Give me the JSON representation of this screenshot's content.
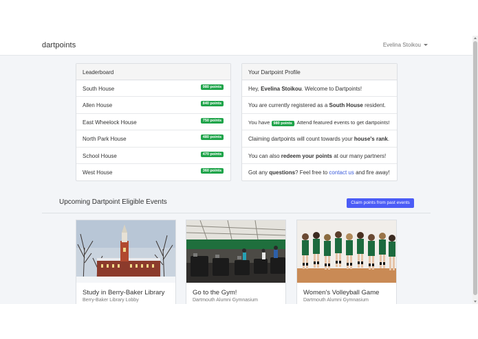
{
  "app": {
    "brand": "dartpoints",
    "user_name": "Evelina Stoikou"
  },
  "leaderboard": {
    "title": "Leaderboard",
    "rows": [
      {
        "house": "South House",
        "points": "980 points"
      },
      {
        "house": "Allen House",
        "points": "840 points"
      },
      {
        "house": "East Wheelock House",
        "points": "750 points"
      },
      {
        "house": "North Park House",
        "points": "480 points"
      },
      {
        "house": "School House",
        "points": "470 points"
      },
      {
        "house": "West House",
        "points": "360 points"
      }
    ]
  },
  "profile": {
    "title": "Your Dartpoint Profile",
    "greeting_pre": "Hey, ",
    "greeting_name": "Evelina Stoikou",
    "greeting_post": ". Welcome to Dartpoints!",
    "registered_pre": "You are currently registered as a ",
    "registered_house": "South House",
    "registered_post": " resident.",
    "have_pre": "You have ",
    "have_points": "980 points",
    "have_post": ". Attend featured events to get dartpoints!",
    "claim_pre": "Claiming dartpoints will count towards your ",
    "claim_bold": "house's rank",
    "claim_post": ".",
    "redeem_pre": "You can also ",
    "redeem_bold": "redeem your points",
    "redeem_post": " at our many partners!",
    "q_pre": "Got any ",
    "q_bold": "questions",
    "q_mid": "? Feel free to ",
    "q_link": "contact us",
    "q_post": " and fire away!"
  },
  "events": {
    "title": "Upcoming Dartpoint Eligible Events",
    "claim_button": "Claim points from past events",
    "cards": [
      {
        "title": "Study in Berry-Baker Library",
        "location": "Berry-Baker Library Lobby"
      },
      {
        "title": "Go to the Gym!",
        "location": "Dartmouth Alumni Gymnasium"
      },
      {
        "title": "Women's Volleyball Game",
        "location": "Dartmouth Alumni Gymnasium"
      }
    ]
  },
  "colors": {
    "accent": "#4b5cf6",
    "badge": "#1fa44a",
    "link": "#3b5bdb"
  }
}
